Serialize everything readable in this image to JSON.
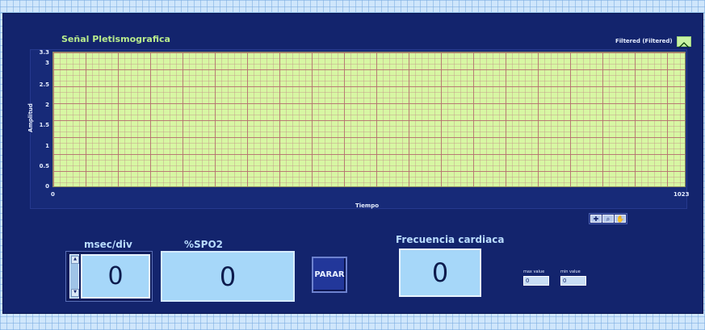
{
  "chart": {
    "title": "Señal Pletismografica",
    "legend": "Filtered (Filtered)",
    "xlabel": "Tiempo",
    "ylabel": "Amplitud",
    "yticks": [
      "3.3",
      "3",
      "2.5",
      "2",
      "1.5",
      "1",
      "0.5",
      "0"
    ],
    "xticks": [
      "0",
      "1023"
    ]
  },
  "chart_data": {
    "type": "line",
    "title": "Señal Pletismografica",
    "xlabel": "Tiempo",
    "ylabel": "Amplitud",
    "xlim": [
      0,
      1023
    ],
    "ylim": [
      0,
      3.3
    ],
    "grid": true,
    "legend_placement": "top-right",
    "series": [
      {
        "name": "Filtered (Filtered)",
        "values": []
      }
    ]
  },
  "controls": {
    "msec_div": {
      "label": "msec/div",
      "value": "0"
    },
    "spo2": {
      "label": "%SPO2",
      "value": "0"
    },
    "heart_rate": {
      "label": "Frecuencia cardiaca",
      "value": "0"
    },
    "stop_button": "PARAR",
    "max_value": {
      "label": "max value",
      "value": "0"
    },
    "min_value": {
      "label": "min value",
      "value": "0"
    }
  },
  "colors": {
    "panel": "#13246d",
    "plot_background": "#d7f7a3",
    "display": "#a6d7f9",
    "title_green": "#b9ec8c"
  },
  "icons": [
    "zoom-icon",
    "pan-icon",
    "cursor-icon",
    "spin-up-icon",
    "spin-down-icon"
  ]
}
